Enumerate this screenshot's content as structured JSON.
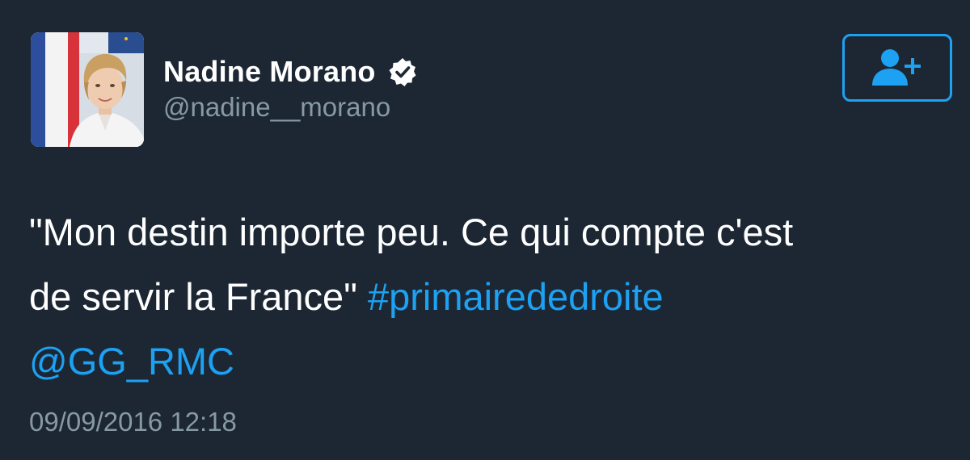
{
  "tweet": {
    "author": {
      "display_name": "Nadine Morano",
      "handle": "@nadine__morano",
      "verified_icon": "verified-badge-icon",
      "avatar_icon": "profile-photo"
    },
    "follow_button": {
      "icon": "add-user-icon"
    },
    "text": {
      "line1": "\"Mon destin importe peu. Ce qui compte c'est",
      "line2_prefix": "de servir la France\" ",
      "hashtag": "#primairededroite",
      "mention": "@GG_RMC"
    },
    "timestamp": "09/09/2016 12:18"
  },
  "colors": {
    "background": "#1c2733",
    "link": "#1da1f2",
    "secondary_text": "#8899a6",
    "primary_text": "#ffffff"
  }
}
